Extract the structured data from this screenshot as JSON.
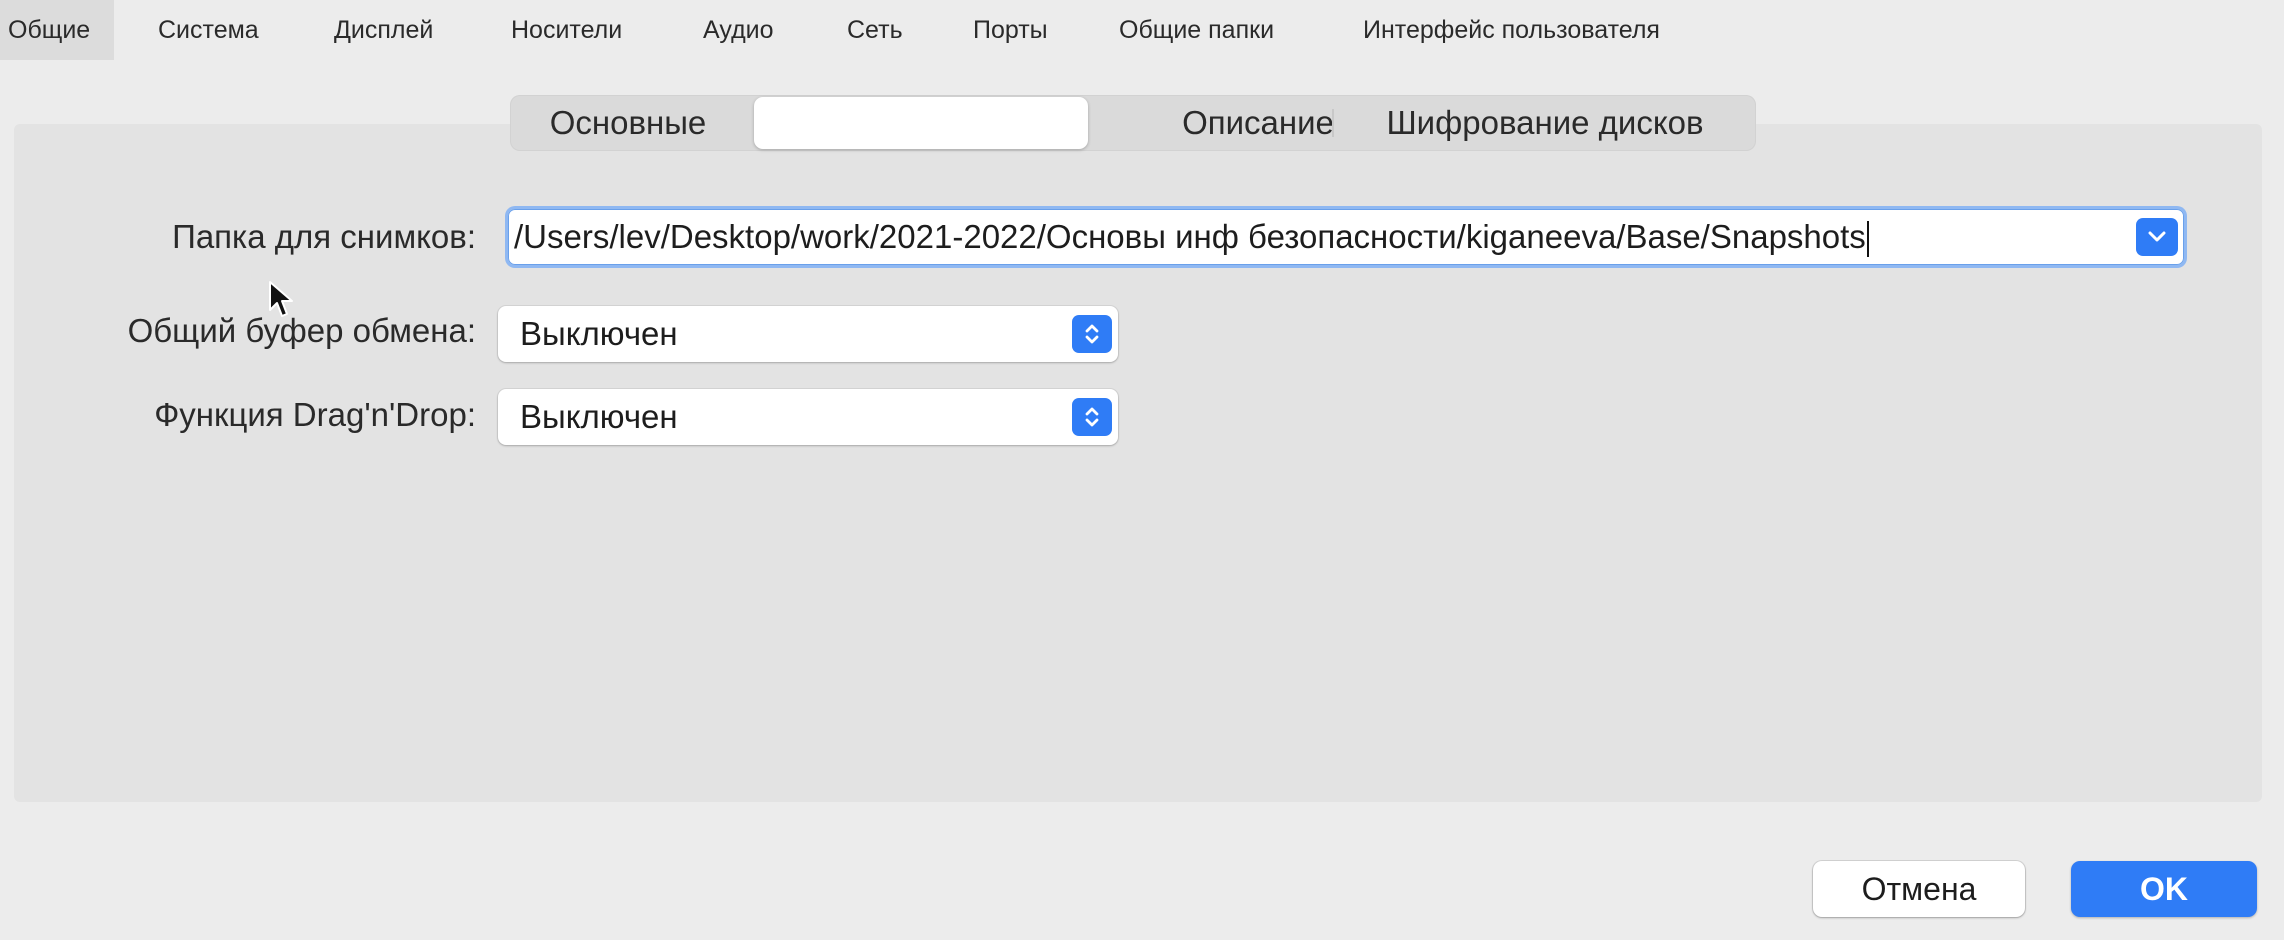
{
  "top_tabs": [
    {
      "label": "Общие",
      "active": true
    },
    {
      "label": "Система"
    },
    {
      "label": "Дисплей"
    },
    {
      "label": "Носители"
    },
    {
      "label": "Аудио"
    },
    {
      "label": "Сеть"
    },
    {
      "label": "Порты"
    },
    {
      "label": "Общие папки"
    },
    {
      "label": "Интерфейс пользователя"
    }
  ],
  "sub_tabs": [
    {
      "label": "Основные"
    },
    {
      "label": "",
      "selected": true
    },
    {
      "label": "Описание"
    },
    {
      "label": "Шифрование дисков"
    }
  ],
  "form": {
    "snapshot_folder_label": "Папка для снимков:",
    "snapshot_folder_value": "/Users/lev/Desktop/work/2021-2022/Основы инф безопасности/kiganeeva/Base/Snapshots",
    "clipboard_label": "Общий буфер обмена:",
    "clipboard_value": "Выключен",
    "dragdrop_label": "Функция Drag'n'Drop:",
    "dragdrop_value": "Выключен"
  },
  "buttons": {
    "cancel": "Отмена",
    "ok": "OK"
  },
  "icons": {
    "combo_button": "chevron-down-icon",
    "select_button": "updown-chevron-icon",
    "pointer": "mouse-pointer-icon"
  },
  "colors": {
    "accent": "#2f7cf6",
    "window_bg": "#ececec",
    "panel_bg": "#e3e3e3"
  }
}
